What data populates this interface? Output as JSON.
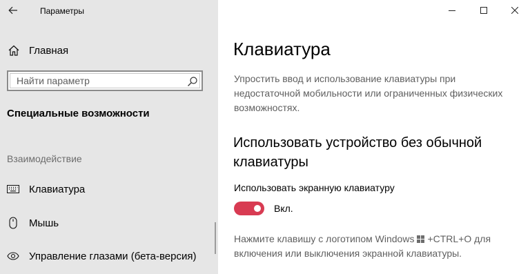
{
  "window": {
    "title": "Параметры"
  },
  "sidebar": {
    "home_label": "Главная",
    "search": {
      "placeholder": "Найти параметр",
      "value": ""
    },
    "section_title": "Специальные возможности",
    "group_header": "Взаимодействие",
    "items": [
      {
        "label": "Клавиатура",
        "icon": "keyboard-icon"
      },
      {
        "label": "Мышь",
        "icon": "mouse-icon"
      },
      {
        "label": "Управление глазами (бета-версия)",
        "icon": "eye-icon"
      }
    ]
  },
  "main": {
    "page_title": "Клавиатура",
    "description": "Упростить ввод и использование клавиатуры при недостаточной мобильности или ограниченных физических возможностях.",
    "section_heading": "Использовать устройство без обычной клавиатуры",
    "setting_label": "Использовать экранную клавиатуру",
    "toggle": {
      "state": "on",
      "state_label": "Вкл."
    },
    "hint_before": "Нажмите клавишу с логотипом Windows",
    "hint_after": "+CTRL+O для включения или выключения экранной клавиатуры."
  },
  "colors": {
    "accent": "#d83b52",
    "sidebar_bg": "#e6e6e6",
    "secondary_text": "#5f5f5f"
  }
}
